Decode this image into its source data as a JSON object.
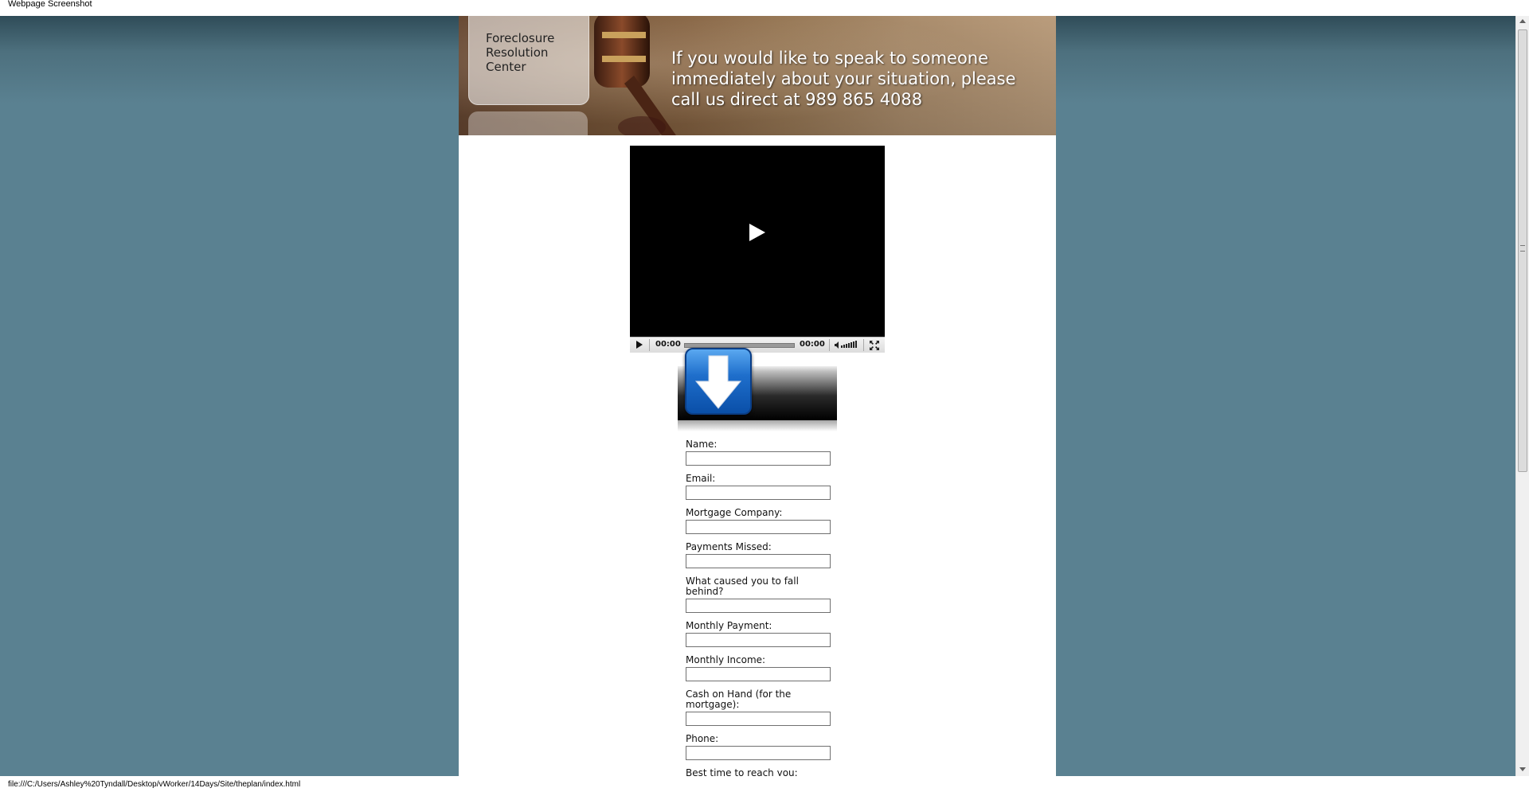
{
  "caption": "Webpage Screenshot",
  "header": {
    "logo_lines": [
      "Foreclosure",
      "Resolution",
      "Center"
    ],
    "message": "If you would like to speak to someone immediately about your situation, please call us direct at 989 865 4088"
  },
  "video": {
    "current_time": "00:00",
    "duration": "00:00"
  },
  "form": {
    "fields": [
      {
        "label": "Name:",
        "value": ""
      },
      {
        "label": "Email:",
        "value": ""
      },
      {
        "label": "Mortgage Company:",
        "value": ""
      },
      {
        "label": "Payments Missed:",
        "value": ""
      },
      {
        "label": "What caused you to fall behind?",
        "value": ""
      },
      {
        "label": "Monthly Payment:",
        "value": ""
      },
      {
        "label": "Monthly Income:",
        "value": ""
      },
      {
        "label": "Cash on Hand (for the mortgage):",
        "value": ""
      },
      {
        "label": "Phone:",
        "value": ""
      },
      {
        "label": "Best time to reach you:",
        "value": ""
      }
    ]
  },
  "status_bar": {
    "url": "file:///C:/Users/Ashley%20Tyndall/Desktop/vWorker/14Days/Site/theplan/index.html"
  },
  "colors": {
    "background": "#5a8191",
    "header_brown": "#8a6644",
    "arrow_blue": "#1f6fcc"
  }
}
